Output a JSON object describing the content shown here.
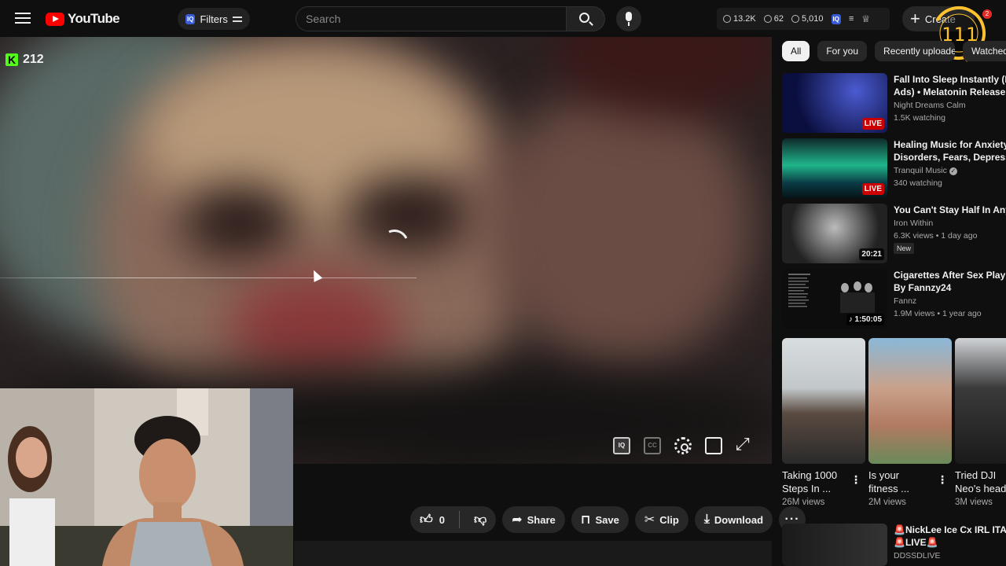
{
  "header": {
    "logo_text": "YouTube",
    "filters_label": "Filters",
    "iq_label": "IQ",
    "search_placeholder": "Search",
    "stats": [
      "13.2K",
      "62",
      "5,010"
    ],
    "create_label": "Create",
    "ring_counter": "111",
    "notification_count": "2"
  },
  "video": {
    "kick_viewers": "212",
    "controls": [
      "iq-icon",
      "captions-icon",
      "settings-gear-icon",
      "theater-mode-icon",
      "fullscreen-icon"
    ]
  },
  "actions": {
    "like_count": "0",
    "share_label": "Share",
    "save_label": "Save",
    "clip_label": "Clip",
    "download_label": "Download"
  },
  "sidebar": {
    "chips": [
      "All",
      "For you",
      "Recently uploaded",
      "Watched"
    ],
    "recommendations": [
      {
        "title_1": "Fall Into Sleep Instantly (No",
        "title_2": "Ads) • Melatonin Release, ...",
        "channel": "Night Dreams Calm",
        "meta": "1.5K watching",
        "badge": "LIVE"
      },
      {
        "title_1": "Healing Music for Anxiety",
        "title_2": "Disorders, Fears, Depression",
        "channel": "Tranquil Music",
        "meta": "340 watching",
        "badge": "LIVE"
      },
      {
        "title_1": "You Can't Stay Half In Anyme",
        "title_2": "",
        "channel": "Iron Within",
        "meta": "6.3K views • 1 day ago",
        "badge": "20:21",
        "extra": "New"
      },
      {
        "title_1": "Cigarettes After Sex Playlist",
        "title_2": "By Fannzy24",
        "channel": "Fannz",
        "meta": "1.9M views • 1 year ago",
        "badge": "1:50:05"
      }
    ],
    "shorts": [
      {
        "title_1": "Taking 1000",
        "title_2": "Steps In ...",
        "views": "26M views"
      },
      {
        "title_1": "Is your",
        "title_2": "fitness ...",
        "views": "2M views"
      },
      {
        "title_1": "Tried DJI",
        "title_2": "Neo's head",
        "views": "3M views"
      }
    ],
    "last": {
      "title_1": "🚨NickLee Ice Cx IRL ITALY",
      "title_2": "🚨LIVE🚨",
      "channel": "DDSSDLIVE"
    }
  },
  "colors": {
    "accent_red": "#ff0000",
    "kick_green": "#53fc18",
    "ring_gold": "#ffc12e"
  }
}
